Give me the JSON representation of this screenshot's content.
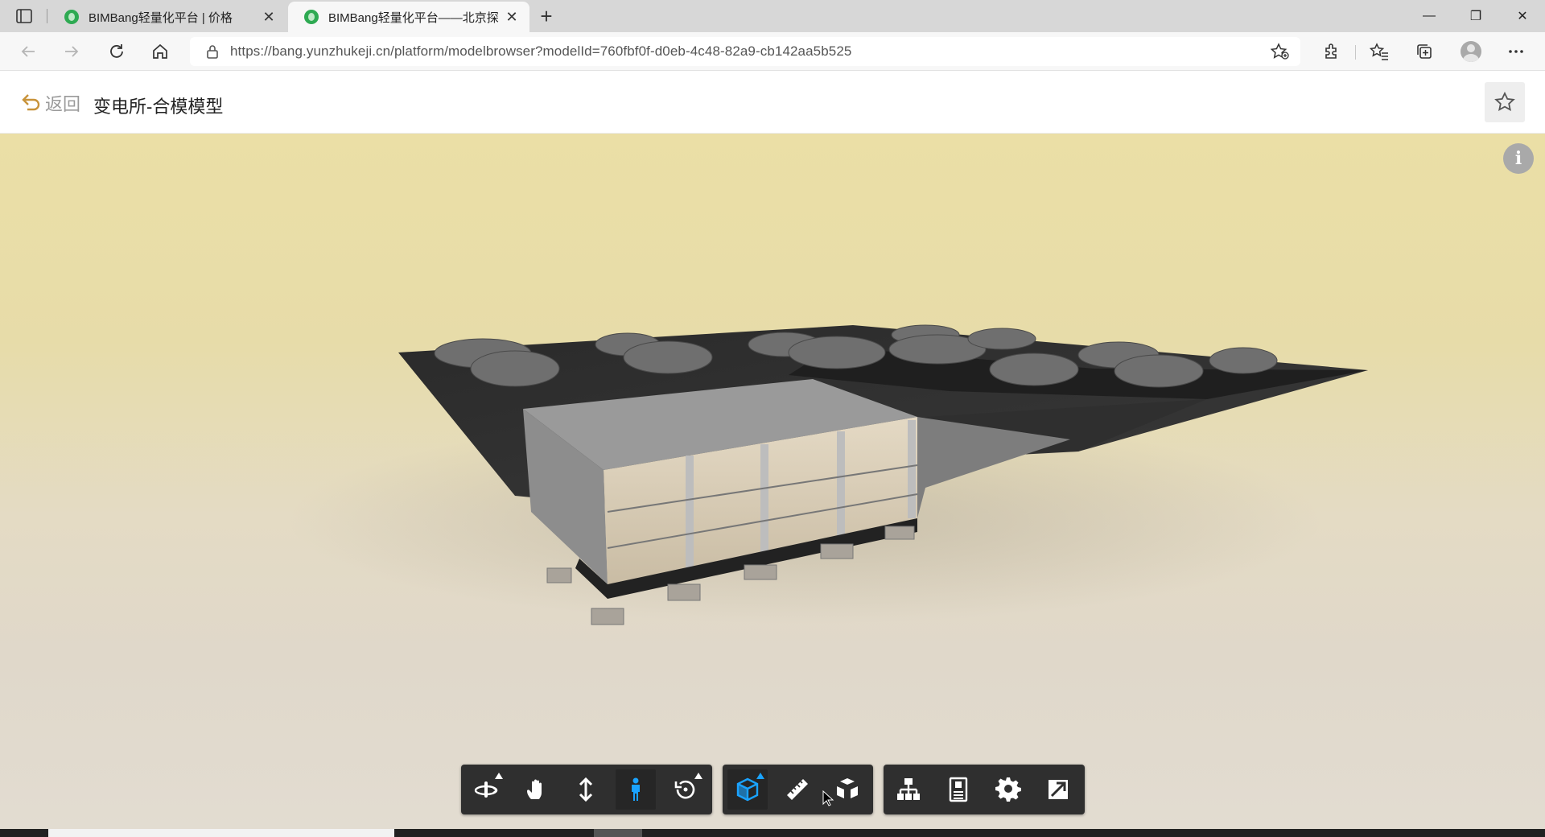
{
  "browser": {
    "tabs": [
      {
        "title": "BIMBang轻量化平台 | 价格",
        "active": false
      },
      {
        "title": "BIMBang轻量化平台——北京探",
        "active": true
      }
    ],
    "new_tab_symbol": "+",
    "close_symbol": "✕",
    "url": "https://bang.yunzhukeji.cn/platform/modelbrowser?modelId=760fbf0f-d0eb-4c48-82a9-cb142aa5b525",
    "window_controls": {
      "minimize": "—",
      "restore": "❐",
      "close": "✕"
    }
  },
  "header": {
    "back_label": "返回",
    "title": "变电所-合模模型"
  },
  "viewer": {
    "info_symbol": "i"
  },
  "toolbar": {
    "groups": [
      [
        {
          "name": "orbit-tool-icon",
          "active": false,
          "has_menu": true
        },
        {
          "name": "pan-tool-icon",
          "active": false,
          "has_menu": false
        },
        {
          "name": "dolly-tool-icon",
          "active": false,
          "has_menu": false
        },
        {
          "name": "first-person-tool-icon",
          "active": true,
          "has_menu": false
        },
        {
          "name": "reset-view-icon",
          "active": false,
          "has_menu": true
        }
      ],
      [
        {
          "name": "section-box-icon",
          "active": true,
          "has_menu": true
        },
        {
          "name": "measure-ruler-icon",
          "active": false,
          "has_menu": false
        },
        {
          "name": "explode-model-icon",
          "active": false,
          "has_menu": false
        }
      ],
      [
        {
          "name": "model-tree-icon",
          "active": false,
          "has_menu": false
        },
        {
          "name": "properties-icon",
          "active": false,
          "has_menu": false
        },
        {
          "name": "settings-gear-icon",
          "active": false,
          "has_menu": false
        },
        {
          "name": "fullscreen-icon",
          "active": false,
          "has_menu": false
        }
      ]
    ],
    "active_color": "#1aa3ff",
    "icon_color": "#ffffff"
  }
}
